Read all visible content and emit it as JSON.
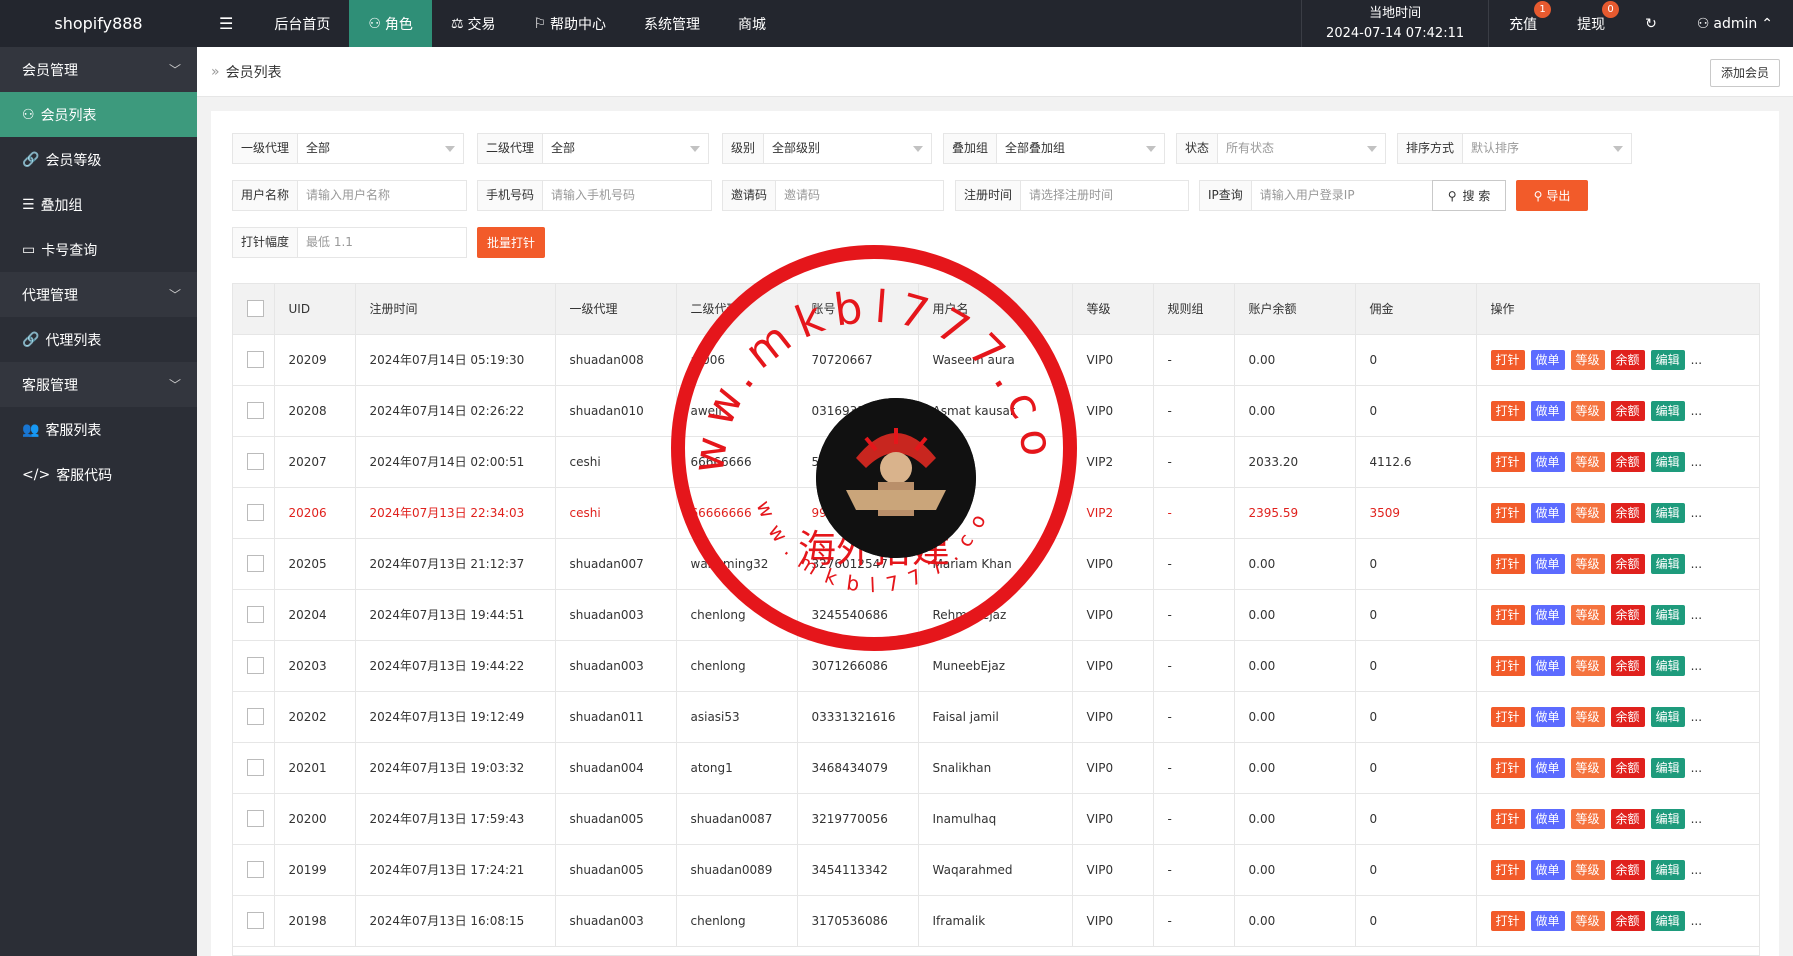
{
  "app": {
    "name": "shopify888"
  },
  "nav": {
    "items": [
      {
        "label": "后台首页",
        "icon": ""
      },
      {
        "label": "角色",
        "icon": "user-icon",
        "active": true
      },
      {
        "label": "交易",
        "icon": "scale-icon"
      },
      {
        "label": "帮助中心",
        "icon": "flag-icon"
      },
      {
        "label": "系统管理",
        "icon": ""
      },
      {
        "label": "商城",
        "icon": ""
      }
    ]
  },
  "topright": {
    "time_label": "当地时间",
    "time_value": "2024-07-14 07:42:11",
    "recharge": "充值",
    "recharge_badge": "1",
    "withdraw": "提现",
    "withdraw_badge": "0",
    "user": "admin"
  },
  "sidebar": {
    "groups": [
      {
        "label": "会员管理",
        "items": [
          {
            "label": "会员列表",
            "icon": "user-icon",
            "active": true
          },
          {
            "label": "会员等级",
            "icon": "link-icon"
          },
          {
            "label": "叠加组",
            "icon": "list-icon"
          },
          {
            "label": "卡号查询",
            "icon": "card-icon"
          }
        ]
      },
      {
        "label": "代理管理",
        "items": [
          {
            "label": "代理列表",
            "icon": "link-icon"
          }
        ]
      },
      {
        "label": "客服管理",
        "items": [
          {
            "label": "客服列表",
            "icon": "users-icon"
          },
          {
            "label": "客服代码",
            "icon": "code-icon"
          }
        ]
      }
    ]
  },
  "breadcrumb": {
    "current": "会员列表",
    "add_button": "添加会员"
  },
  "filters": {
    "agent1": {
      "label": "一级代理",
      "value": "全部"
    },
    "agent2": {
      "label": "二级代理",
      "value": "全部"
    },
    "level": {
      "label": "级别",
      "value": "全部级别"
    },
    "group": {
      "label": "叠加组",
      "value": "全部叠加组"
    },
    "status": {
      "label": "状态",
      "placeholder": "所有状态"
    },
    "sort": {
      "label": "排序方式",
      "placeholder": "默认排序"
    },
    "username": {
      "label": "用户名称",
      "placeholder": "请输入用户名称"
    },
    "phone": {
      "label": "手机号码",
      "placeholder": "请输入手机号码"
    },
    "invite": {
      "label": "邀请码",
      "placeholder": "邀请码"
    },
    "regtime": {
      "label": "注册时间",
      "placeholder": "请选择注册时间"
    },
    "ip": {
      "label": "IP查询",
      "placeholder": "请输入用户登录IP"
    },
    "range": {
      "label": "打针幅度",
      "placeholder": "最低 1.1"
    },
    "search_btn": "搜 索",
    "export_btn": "导出",
    "batch_btn": "批量打针"
  },
  "table": {
    "headers": [
      "UID",
      "注册时间",
      "一级代理",
      "二级代理",
      "账号",
      "用户名",
      "等级",
      "规则组",
      "账户余额",
      "佣金",
      "操作"
    ],
    "actions": [
      "打针",
      "做单",
      "等级",
      "余额",
      "编辑",
      "..."
    ],
    "rows": [
      {
        "uid": "20209",
        "time": "2024年07月14日 05:19:30",
        "a1": "shuadan008",
        "a2": "af006",
        "acct": "70720667",
        "name": "Waseem aura",
        "level": "VIP0",
        "rule": "-",
        "bal": "0.00",
        "comm": "0"
      },
      {
        "uid": "20208",
        "time": "2024年07月14日 02:26:22",
        "a1": "shuadan010",
        "a2": "aweil",
        "acct": "0316933",
        "name": "Asmat kausar",
        "level": "VIP0",
        "rule": "-",
        "bal": "0.00",
        "comm": "0"
      },
      {
        "uid": "20207",
        "time": "2024年07月14日 02:00:51",
        "a1": "ceshi",
        "a2": "66666666",
        "acct": "5",
        "name": "",
        "level": "VIP2",
        "rule": "-",
        "bal": "2033.20",
        "comm": "4112.6"
      },
      {
        "uid": "20206",
        "time": "2024年07月13日 22:34:03",
        "a1": "ceshi",
        "a2": "66666666",
        "acct": "99",
        "name": "",
        "level": "VIP2",
        "rule": "-",
        "bal": "2395.59",
        "comm": "3509",
        "red": true
      },
      {
        "uid": "20205",
        "time": "2024年07月13日 21:12:37",
        "a1": "shuadan007",
        "a2": "wangming32",
        "acct": "3276012547",
        "name": "Mariam Khan",
        "level": "VIP0",
        "rule": "-",
        "bal": "0.00",
        "comm": "0"
      },
      {
        "uid": "20204",
        "time": "2024年07月13日 19:44:51",
        "a1": "shuadan003",
        "a2": "chenlong",
        "acct": "3245540686",
        "name": "Rehmanejaz",
        "level": "VIP0",
        "rule": "-",
        "bal": "0.00",
        "comm": "0"
      },
      {
        "uid": "20203",
        "time": "2024年07月13日 19:44:22",
        "a1": "shuadan003",
        "a2": "chenlong",
        "acct": "3071266086",
        "name": "MuneebEjaz",
        "level": "VIP0",
        "rule": "-",
        "bal": "0.00",
        "comm": "0"
      },
      {
        "uid": "20202",
        "time": "2024年07月13日 19:12:49",
        "a1": "shuadan011",
        "a2": "asiasi53",
        "acct": "03331321616",
        "name": "Faisal jamil",
        "level": "VIP0",
        "rule": "-",
        "bal": "0.00",
        "comm": "0"
      },
      {
        "uid": "20201",
        "time": "2024年07月13日 19:03:32",
        "a1": "shuadan004",
        "a2": "atong1",
        "acct": "3468434079",
        "name": "Snalikhan",
        "level": "VIP0",
        "rule": "-",
        "bal": "0.00",
        "comm": "0"
      },
      {
        "uid": "20200",
        "time": "2024年07月13日 17:59:43",
        "a1": "shuadan005",
        "a2": "shuadan0087",
        "acct": "3219770056",
        "name": "Inamulhaq",
        "level": "VIP0",
        "rule": "-",
        "bal": "0.00",
        "comm": "0"
      },
      {
        "uid": "20199",
        "time": "2024年07月13日 17:24:21",
        "a1": "shuadan005",
        "a2": "shuadan0089",
        "acct": "3454113342",
        "name": "Waqarahmed",
        "level": "VIP0",
        "rule": "-",
        "bal": "0.00",
        "comm": "0"
      },
      {
        "uid": "20198",
        "time": "2024年07月13日 16:08:15",
        "a1": "shuadan003",
        "a2": "chenlong",
        "acct": "3170536086",
        "name": "Iframalik",
        "level": "VIP0",
        "rule": "-",
        "bal": "0.00",
        "comm": "0"
      }
    ]
  },
  "watermark": {
    "url_top": "www.mkbl777.com",
    "url_bottom": "www.mkbl777.com",
    "text": "海外搭建",
    "color": "#e5161b"
  }
}
